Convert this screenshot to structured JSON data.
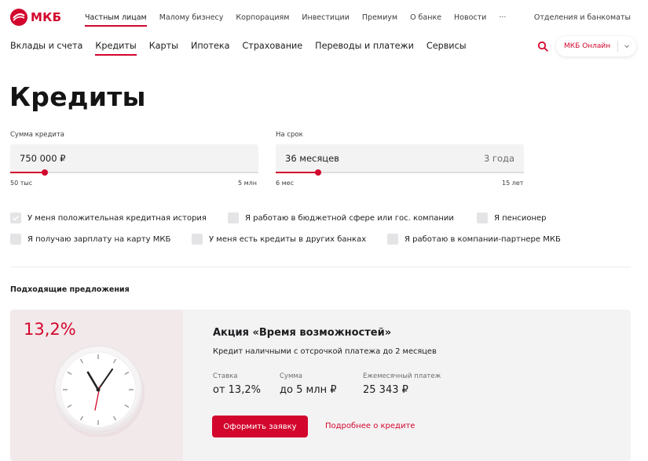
{
  "brand": {
    "name": "МКБ",
    "accent": "#d3062d"
  },
  "top_nav": {
    "items": [
      "Частным лицам",
      "Малому бизнесу",
      "Корпорациям",
      "Инвестиции",
      "Премиум",
      "О банке",
      "Новости",
      "···"
    ],
    "active_index": 0,
    "right_link": "Отделения и банкоматы"
  },
  "main_nav": {
    "items": [
      "Вклады и счета",
      "Кредиты",
      "Карты",
      "Ипотека",
      "Страхование",
      "Переводы и платежи",
      "Сервисы"
    ],
    "active_index": 1,
    "search_icon": "search-icon",
    "online_button": "МКБ Онлайн"
  },
  "page": {
    "title": "Кредиты"
  },
  "calculator": {
    "amount": {
      "label": "Сумма кредита",
      "value": "750 000 ₽",
      "min": "50 тыс",
      "max": "5 млн",
      "progress": 0.14
    },
    "term": {
      "label": "На срок",
      "value": "36 месяцев",
      "suffix": "3 года",
      "min": "6 мес",
      "max": "15 лет",
      "progress": 0.17
    }
  },
  "filters": [
    {
      "label": "У меня положительная кредитная история",
      "checked": true
    },
    {
      "label": "Я работаю в бюджетной сфере или гос. компании",
      "checked": false
    },
    {
      "label": "Я пенсионер",
      "checked": false
    },
    {
      "label": "Я получаю зарплату на карту МКБ",
      "checked": false
    },
    {
      "label": "У меня есть кредиты в других банках",
      "checked": false
    },
    {
      "label": "Я работаю в компании-партнере МКБ",
      "checked": false
    }
  ],
  "offers_section": {
    "title": "Подходящие предложения"
  },
  "offer": {
    "rate_badge": "13,2%",
    "title": "Акция «Время возможностей»",
    "description": "Кредит наличными с отсрочкой платежа до 2 месяцев",
    "stats": [
      {
        "label": "Ставка",
        "value": "от 13,2%"
      },
      {
        "label": "Сумма",
        "value": "до 5 млн ₽"
      },
      {
        "label": "Ежемесячный платеж",
        "value": "25 343 ₽"
      }
    ],
    "apply_button": "Оформить заявку",
    "more_link": "Подробнее о кредите"
  }
}
